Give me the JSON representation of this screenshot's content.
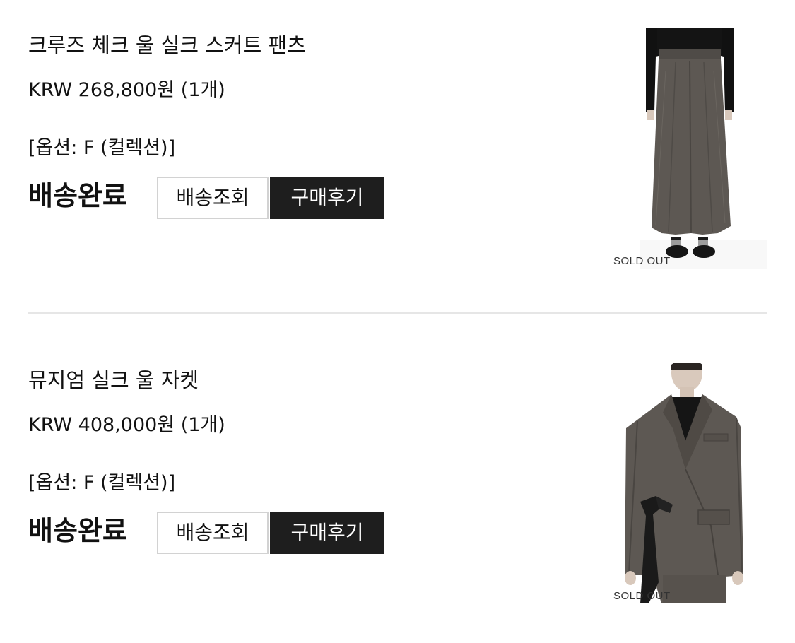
{
  "orders": [
    {
      "product_name": "크루즈 체크 울 실크 스커트 팬츠",
      "price": "KRW 268,800원 (1개)",
      "option": "[옵션: F (컬렉션)]",
      "status": "배송완료",
      "track_button": "배송조회",
      "review_button": "구매후기",
      "thumbnail_badge": "SOLD OUT",
      "thumbnail_icon": "skirt-pants-photo"
    },
    {
      "product_name": "뮤지엄 실크 울 자켓",
      "price": "KRW 408,000원 (1개)",
      "option": "[옵션: F (컬렉션)]",
      "status": "배송완료",
      "track_button": "배송조회",
      "review_button": "구매후기",
      "thumbnail_badge": "SOLD OUT",
      "thumbnail_icon": "jacket-photo"
    }
  ],
  "colors": {
    "text": "#111111",
    "review_button_bg": "#1e1e1e",
    "track_button_border": "#d2d2d2",
    "divider": "#e6e6e6",
    "garment_gray": "#5d5853"
  }
}
